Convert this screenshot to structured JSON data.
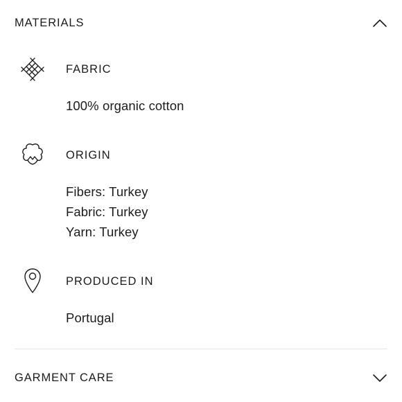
{
  "materials": {
    "title": "MATERIALS",
    "expanded": true,
    "sections": [
      {
        "icon": "fabric-weave-icon",
        "label": "FABRIC",
        "values": [
          "100% organic cotton"
        ]
      },
      {
        "icon": "cotton-boll-icon",
        "label": "ORIGIN",
        "values": [
          "Fibers: Turkey",
          "Fabric: Turkey",
          "Yarn: Turkey"
        ]
      },
      {
        "icon": "location-pin-icon",
        "label": "PRODUCED IN",
        "values": [
          "Portugal"
        ]
      }
    ]
  },
  "garment_care": {
    "title": "GARMENT CARE",
    "expanded": false
  }
}
